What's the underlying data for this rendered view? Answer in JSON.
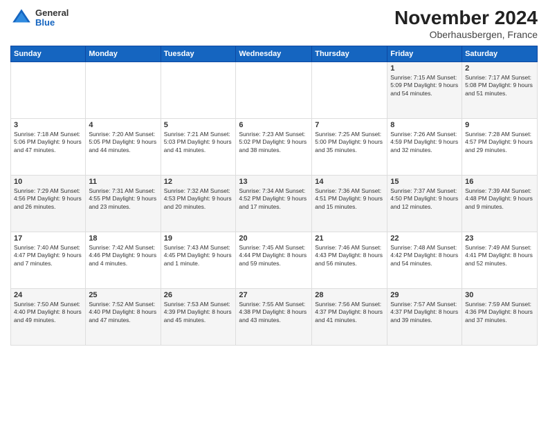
{
  "header": {
    "logo_general": "General",
    "logo_blue": "Blue",
    "title": "November 2024",
    "location": "Oberhausbergen, France"
  },
  "weekdays": [
    "Sunday",
    "Monday",
    "Tuesday",
    "Wednesday",
    "Thursday",
    "Friday",
    "Saturday"
  ],
  "weeks": [
    [
      {
        "day": "",
        "info": ""
      },
      {
        "day": "",
        "info": ""
      },
      {
        "day": "",
        "info": ""
      },
      {
        "day": "",
        "info": ""
      },
      {
        "day": "",
        "info": ""
      },
      {
        "day": "1",
        "info": "Sunrise: 7:15 AM\nSunset: 5:09 PM\nDaylight: 9 hours\nand 54 minutes."
      },
      {
        "day": "2",
        "info": "Sunrise: 7:17 AM\nSunset: 5:08 PM\nDaylight: 9 hours\nand 51 minutes."
      }
    ],
    [
      {
        "day": "3",
        "info": "Sunrise: 7:18 AM\nSunset: 5:06 PM\nDaylight: 9 hours\nand 47 minutes."
      },
      {
        "day": "4",
        "info": "Sunrise: 7:20 AM\nSunset: 5:05 PM\nDaylight: 9 hours\nand 44 minutes."
      },
      {
        "day": "5",
        "info": "Sunrise: 7:21 AM\nSunset: 5:03 PM\nDaylight: 9 hours\nand 41 minutes."
      },
      {
        "day": "6",
        "info": "Sunrise: 7:23 AM\nSunset: 5:02 PM\nDaylight: 9 hours\nand 38 minutes."
      },
      {
        "day": "7",
        "info": "Sunrise: 7:25 AM\nSunset: 5:00 PM\nDaylight: 9 hours\nand 35 minutes."
      },
      {
        "day": "8",
        "info": "Sunrise: 7:26 AM\nSunset: 4:59 PM\nDaylight: 9 hours\nand 32 minutes."
      },
      {
        "day": "9",
        "info": "Sunrise: 7:28 AM\nSunset: 4:57 PM\nDaylight: 9 hours\nand 29 minutes."
      }
    ],
    [
      {
        "day": "10",
        "info": "Sunrise: 7:29 AM\nSunset: 4:56 PM\nDaylight: 9 hours\nand 26 minutes."
      },
      {
        "day": "11",
        "info": "Sunrise: 7:31 AM\nSunset: 4:55 PM\nDaylight: 9 hours\nand 23 minutes."
      },
      {
        "day": "12",
        "info": "Sunrise: 7:32 AM\nSunset: 4:53 PM\nDaylight: 9 hours\nand 20 minutes."
      },
      {
        "day": "13",
        "info": "Sunrise: 7:34 AM\nSunset: 4:52 PM\nDaylight: 9 hours\nand 17 minutes."
      },
      {
        "day": "14",
        "info": "Sunrise: 7:36 AM\nSunset: 4:51 PM\nDaylight: 9 hours\nand 15 minutes."
      },
      {
        "day": "15",
        "info": "Sunrise: 7:37 AM\nSunset: 4:50 PM\nDaylight: 9 hours\nand 12 minutes."
      },
      {
        "day": "16",
        "info": "Sunrise: 7:39 AM\nSunset: 4:48 PM\nDaylight: 9 hours\nand 9 minutes."
      }
    ],
    [
      {
        "day": "17",
        "info": "Sunrise: 7:40 AM\nSunset: 4:47 PM\nDaylight: 9 hours\nand 7 minutes."
      },
      {
        "day": "18",
        "info": "Sunrise: 7:42 AM\nSunset: 4:46 PM\nDaylight: 9 hours\nand 4 minutes."
      },
      {
        "day": "19",
        "info": "Sunrise: 7:43 AM\nSunset: 4:45 PM\nDaylight: 9 hours\nand 1 minute."
      },
      {
        "day": "20",
        "info": "Sunrise: 7:45 AM\nSunset: 4:44 PM\nDaylight: 8 hours\nand 59 minutes."
      },
      {
        "day": "21",
        "info": "Sunrise: 7:46 AM\nSunset: 4:43 PM\nDaylight: 8 hours\nand 56 minutes."
      },
      {
        "day": "22",
        "info": "Sunrise: 7:48 AM\nSunset: 4:42 PM\nDaylight: 8 hours\nand 54 minutes."
      },
      {
        "day": "23",
        "info": "Sunrise: 7:49 AM\nSunset: 4:41 PM\nDaylight: 8 hours\nand 52 minutes."
      }
    ],
    [
      {
        "day": "24",
        "info": "Sunrise: 7:50 AM\nSunset: 4:40 PM\nDaylight: 8 hours\nand 49 minutes."
      },
      {
        "day": "25",
        "info": "Sunrise: 7:52 AM\nSunset: 4:40 PM\nDaylight: 8 hours\nand 47 minutes."
      },
      {
        "day": "26",
        "info": "Sunrise: 7:53 AM\nSunset: 4:39 PM\nDaylight: 8 hours\nand 45 minutes."
      },
      {
        "day": "27",
        "info": "Sunrise: 7:55 AM\nSunset: 4:38 PM\nDaylight: 8 hours\nand 43 minutes."
      },
      {
        "day": "28",
        "info": "Sunrise: 7:56 AM\nSunset: 4:37 PM\nDaylight: 8 hours\nand 41 minutes."
      },
      {
        "day": "29",
        "info": "Sunrise: 7:57 AM\nSunset: 4:37 PM\nDaylight: 8 hours\nand 39 minutes."
      },
      {
        "day": "30",
        "info": "Sunrise: 7:59 AM\nSunset: 4:36 PM\nDaylight: 8 hours\nand 37 minutes."
      }
    ]
  ]
}
